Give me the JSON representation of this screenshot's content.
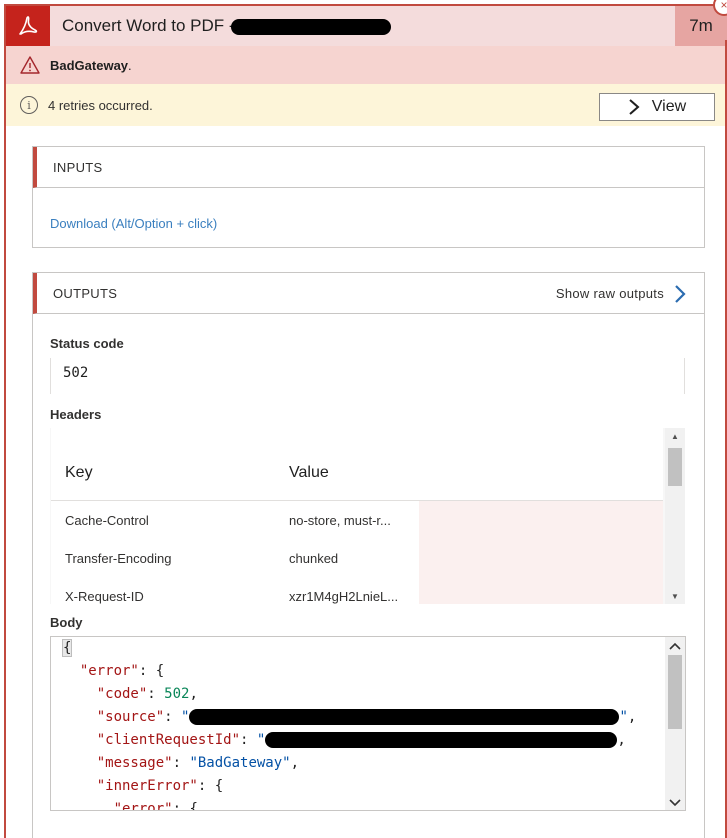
{
  "action": {
    "title": "Convert Word to PDF -",
    "duration": "7m",
    "close_glyph": "×",
    "brand_color": "#c5231c"
  },
  "error": {
    "message": "BadGateway",
    "suffix": "."
  },
  "retry": {
    "message": "4 retries occurred.",
    "view_label": "View"
  },
  "inputs": {
    "heading": "INPUTS",
    "download_label": "Download (Alt/Option + click)"
  },
  "outputs": {
    "heading": "OUTPUTS",
    "raw_label": "Show raw outputs",
    "status_label": "Status code",
    "status_value": "502",
    "headers_label": "Headers",
    "headers_columns": {
      "key": "Key",
      "value": "Value"
    },
    "headers_rows": [
      {
        "key": "Cache-Control",
        "value": "no-store, must-r..."
      },
      {
        "key": "Transfer-Encoding",
        "value": "chunked"
      },
      {
        "key": "X-Request-ID",
        "value": "xzr1M4gH2LnieL..."
      }
    ],
    "body_label": "Body",
    "body_lines": {
      "l1": "{",
      "l2_key": "\"error\"",
      "l3_key": "\"code\"",
      "l3_val": "502",
      "l4_key": "\"source\"",
      "l5_key": "\"clientRequestId\"",
      "l6_key": "\"message\"",
      "l6_val": "\"BadGateway\"",
      "l7_key": "\"innerError\"",
      "l8_key": "\"error\""
    }
  }
}
